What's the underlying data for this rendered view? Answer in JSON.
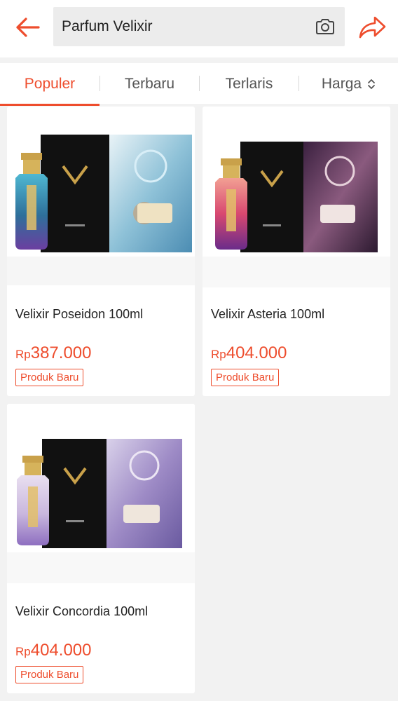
{
  "header": {
    "search_value": "Parfum Velixir",
    "back_icon": "back-arrow-icon",
    "camera_icon": "camera-icon",
    "share_icon": "share-icon"
  },
  "tabs": [
    {
      "label": "Populer",
      "active": true
    },
    {
      "label": "Terbaru",
      "active": false
    },
    {
      "label": "Terlaris",
      "active": false
    },
    {
      "label": "Harga",
      "active": false,
      "icon": "sort-updown-icon"
    }
  ],
  "products": [
    {
      "name": "Velixir Poseidon 100ml",
      "currency": "Rp",
      "price": "387.000",
      "badge": "Produk Baru",
      "theme": "blue"
    },
    {
      "name": "Velixir Asteria 100ml",
      "currency": "Rp",
      "price": "404.000",
      "badge": "Produk Baru",
      "theme": "pink"
    },
    {
      "name": "Velixir Concordia 100ml",
      "currency": "Rp",
      "price": "404.000",
      "badge": "Produk Baru",
      "theme": "lavender"
    }
  ],
  "colors": {
    "accent": "#ee4d2d",
    "background": "#f2f2f2"
  }
}
